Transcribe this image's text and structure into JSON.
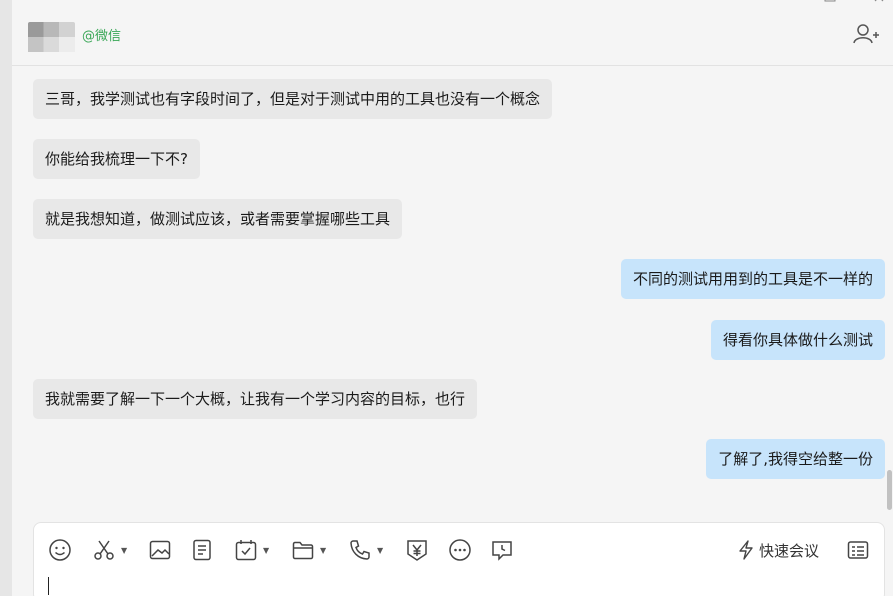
{
  "header": {
    "wechat_tag": "@微信"
  },
  "messages": [
    {
      "side": "in",
      "text": "三哥，我学测试也有字段时间了，但是对于测试中用的工具也没有一个概念"
    },
    {
      "side": "in",
      "text": "你能给我梳理一下不?"
    },
    {
      "side": "in",
      "text": "就是我想知道，做测试应该，或者需要掌握哪些工具"
    },
    {
      "side": "out",
      "text": "不同的测试用用到的工具是不一样的"
    },
    {
      "side": "out",
      "text": "得看你具体做什么测试"
    },
    {
      "side": "in",
      "text": "我就需要了解一下一个大概，让我有一个学习内容的目标，也行"
    },
    {
      "side": "out",
      "text": "了解了,我得空给整一份"
    }
  ],
  "toolbar": {
    "icons": [
      "emoji-icon",
      "scissors-icon",
      "image-icon",
      "document-icon",
      "schedule-icon",
      "folder-icon",
      "phone-icon",
      "yen-icon",
      "more-icon",
      "clock-message-icon"
    ],
    "meeting_label": "快速会议"
  },
  "colors": {
    "incoming_bubble": "#e8e8e8",
    "outgoing_bubble": "#c7e4fb",
    "wechat_green": "#3aa757",
    "background": "#f5f5f5"
  }
}
